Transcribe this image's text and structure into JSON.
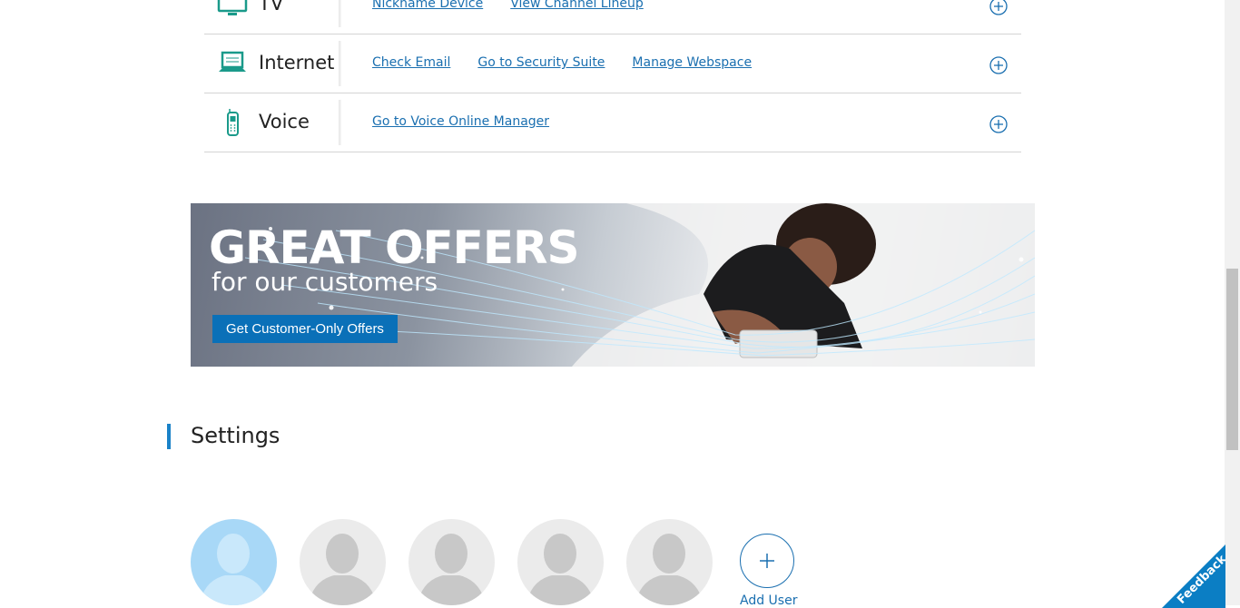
{
  "services": [
    {
      "name": "TV",
      "icon": "tv-icon",
      "links": [
        "Nickname Device",
        "View Channel Lineup"
      ]
    },
    {
      "name": "Internet",
      "icon": "laptop-icon",
      "links": [
        "Check Email",
        "Go to Security Suite",
        "Manage Webspace"
      ]
    },
    {
      "name": "Voice",
      "icon": "phone-icon",
      "links": [
        "Go to Voice Online Manager"
      ]
    }
  ],
  "banner": {
    "headline": "GREAT OFFERS",
    "subheadline": "for our customers",
    "cta": "Get Customer-Only Offers"
  },
  "settings": {
    "title": "Settings",
    "add_user_label": "Add User"
  },
  "feedback_label": "Feedback",
  "colors": {
    "accent": "#1a6fb0",
    "icon_teal": "#1a9a8a",
    "cta_blue": "#0a70b8",
    "feedback_blue": "#0b7ec4"
  }
}
